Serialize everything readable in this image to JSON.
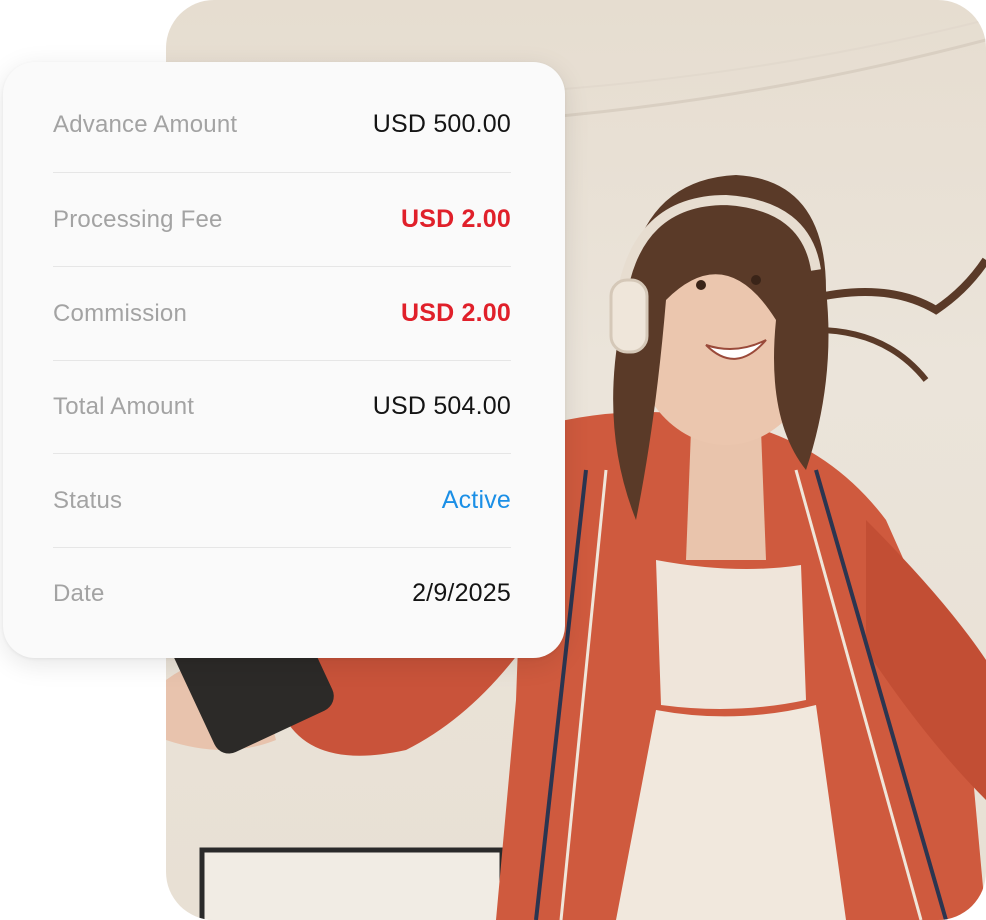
{
  "details": {
    "rows": [
      {
        "label": "Advance Amount",
        "value": "USD 500.00",
        "tone": "default"
      },
      {
        "label": "Processing Fee",
        "value": "USD 2.00",
        "tone": "negative"
      },
      {
        "label": "Commission",
        "value": "USD 2.00",
        "tone": "negative"
      },
      {
        "label": "Total Amount",
        "value": "USD 504.00",
        "tone": "default"
      },
      {
        "label": "Status",
        "value": "Active",
        "tone": "accent"
      },
      {
        "label": "Date",
        "value": "2/9/2025",
        "tone": "default"
      }
    ]
  },
  "colors": {
    "label": "#a3a3a3",
    "value": "#141414",
    "negative": "#e0202a",
    "accent": "#1b8fe6",
    "card_background": "#fafafa"
  },
  "photo": {
    "subject": "woman-with-headphones-dancing-icon"
  }
}
